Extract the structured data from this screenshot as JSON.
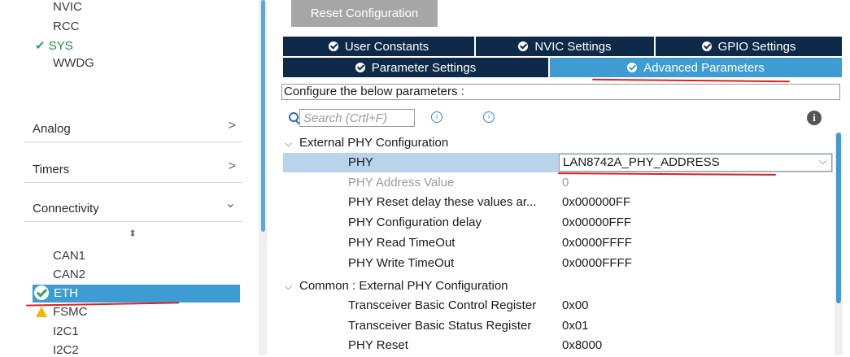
{
  "sidebar": {
    "peripherals_top": [
      "NVIC",
      "RCC",
      "SYS",
      "WWDG"
    ],
    "sys_checked": true,
    "categories": [
      {
        "label": "Analog",
        "arrow": ">"
      },
      {
        "label": "Timers",
        "arrow": ">"
      },
      {
        "label": "Connectivity",
        "arrow": "⌄"
      }
    ],
    "sort_glyph": "⬍",
    "connectivity_items": [
      "CAN1",
      "CAN2",
      "ETH",
      "FSMC",
      "I2C1",
      "I2C2"
    ],
    "selected": "ETH",
    "warning_item": "FSMC"
  },
  "toolbar": {
    "reset_label": "Reset Configuration"
  },
  "tabs": {
    "row1": [
      "User Constants",
      "NVIC Settings",
      "GPIO Settings"
    ],
    "row2": [
      "Parameter Settings",
      "Advanced Parameters"
    ],
    "active": "Advanced Parameters"
  },
  "description": "Configure the below parameters :",
  "search": {
    "placeholder": "Search (Crtl+F)",
    "prev_glyph": "‹",
    "next_glyph": "›",
    "info_glyph": "i"
  },
  "sections": [
    {
      "title": "External PHY Configuration",
      "params": [
        {
          "name": "PHY",
          "value": "LAN8742A_PHY_ADDRESS",
          "selected": true
        },
        {
          "name": "PHY Address Value",
          "value": "0",
          "dim": true
        },
        {
          "name": "PHY Reset delay these values ar...",
          "value": "0x000000FF"
        },
        {
          "name": "PHY Configuration delay",
          "value": "0x00000FFF"
        },
        {
          "name": "PHY Read TimeOut",
          "value": "0x0000FFFF"
        },
        {
          "name": "PHY Write TimeOut",
          "value": "0x0000FFFF"
        }
      ]
    },
    {
      "title": "Common : External PHY Configuration",
      "params": [
        {
          "name": "Transceiver Basic Control Register",
          "value": "0x00"
        },
        {
          "name": "Transceiver Basic Status Register",
          "value": "0x01"
        },
        {
          "name": "PHY Reset",
          "value": "0x8000"
        }
      ]
    }
  ],
  "colors": {
    "tab_dark": "#0f2a48",
    "tab_active": "#3e9cd3",
    "selection": "#b9d3ea",
    "check": "#2fa84f",
    "warn": "#f2b705",
    "annotation": "#e02020"
  }
}
